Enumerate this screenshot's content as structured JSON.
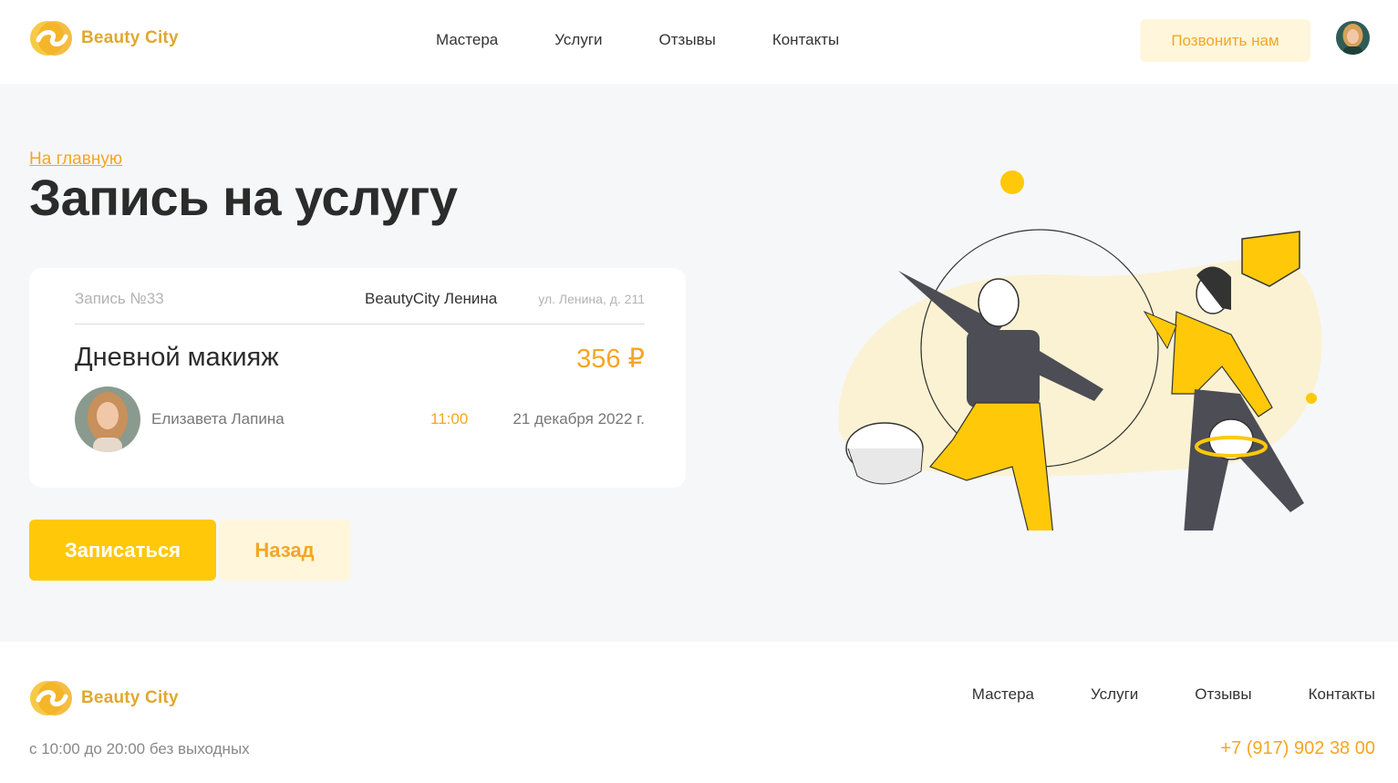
{
  "brand": {
    "name": "Beauty City",
    "color": "#e0a82e",
    "accent": "#f5a623",
    "primary_button": "#ffc909"
  },
  "header": {
    "nav": [
      "Мастера",
      "Услуги",
      "Отзывы",
      "Контакты"
    ],
    "call_label": "Позвонить нам"
  },
  "breadcrumb": "На главную",
  "page_title": "Запись на услугу",
  "booking": {
    "record_no": "Запись №33",
    "salon": "BeautyCity Ленина",
    "address": "ул. Ленина, д. 211",
    "service": "Дневной макияж",
    "price": "356 ₽",
    "master": "Елизавета Лапина",
    "time": "11:00",
    "date": "21 декабря 2022 г."
  },
  "actions": {
    "book_label": "Записаться",
    "back_label": "Назад"
  },
  "footer": {
    "nav": [
      "Мастера",
      "Услуги",
      "Отзывы",
      "Контакты"
    ],
    "hours": "с 10:00 до 20:00 без выходных",
    "phone": "+7 (917) 902 38 00"
  }
}
